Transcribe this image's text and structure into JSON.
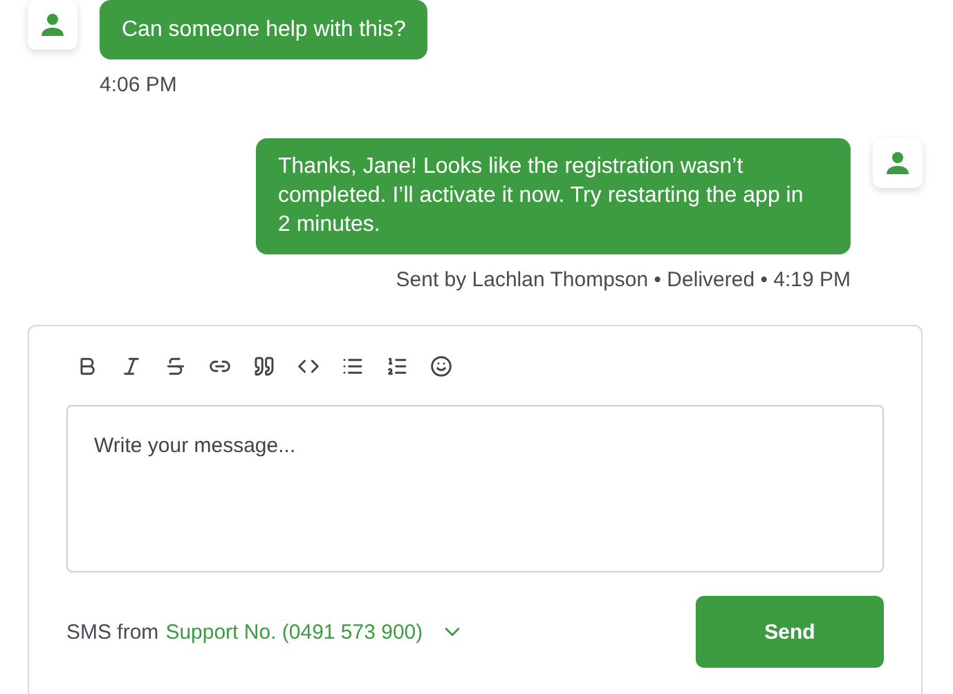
{
  "messages": [
    {
      "kind": "incoming",
      "text": "Can someone help with this?",
      "meta": "4:06 PM"
    },
    {
      "kind": "outgoing",
      "text": "Thanks, Jane! Looks like the registration wasn’t completed. I’ll activate it now. Try restarting the app in 2 minutes.",
      "meta": "Sent by Lachlan Thompson • Delivered • 4:19 PM"
    }
  ],
  "composer": {
    "placeholder": "Write your message...",
    "sender_label": "SMS from",
    "sender": "Support No. (0491 573 900)",
    "send_button": "Send"
  }
}
